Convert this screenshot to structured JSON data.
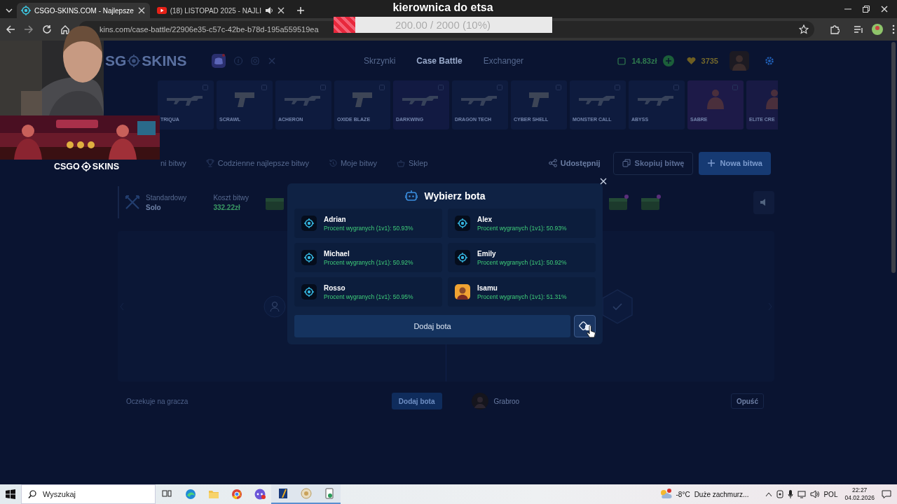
{
  "browser": {
    "tabs": [
      {
        "title": "CSGO-SKINS.COM - Najlepsze",
        "kind": "site",
        "selected": true
      },
      {
        "title": "(18) LISTOPAD 2025 - NAJLI",
        "kind": "video",
        "selected": false
      }
    ],
    "address": "kins.com/case-battle/22906e35-c57c-42be-b78d-195a559519ea"
  },
  "stream": {
    "goal_title": "kierownica do etsa",
    "goal_reading": "200.00 / 2000 (10%)",
    "level": 0.1,
    "logo_left": "CSGO",
    "logo_right": "SKINS"
  },
  "header": {
    "logo_left": "SG",
    "logo_right": "SKINS",
    "nav": [
      {
        "label": "Skrzynki",
        "selected": false
      },
      {
        "label": "Case Battle",
        "selected": true
      },
      {
        "label": "Exchanger",
        "selected": false
      }
    ],
    "balance": "14.83zł",
    "coins": "3735"
  },
  "drops": [
    {
      "name": "TRIQUA",
      "kind": "rifle",
      "color": "#0e1b3e"
    },
    {
      "name": "SCRAWL",
      "kind": "pistol",
      "color": "#0e1b3e"
    },
    {
      "name": "ACHERON",
      "kind": "rifle",
      "color": "#0e1b3e"
    },
    {
      "name": "OXIDE BLAZE",
      "kind": "pistol",
      "color": "#0e1b3e"
    },
    {
      "name": "DARKWING",
      "kind": "rifle",
      "color": "#121a42"
    },
    {
      "name": "DRAGON TECH",
      "kind": "rifle",
      "color": "#0e1b3e"
    },
    {
      "name": "CYBER SHELL",
      "kind": "pistol",
      "color": "#0e1b3e"
    },
    {
      "name": "MONSTER CALL",
      "kind": "rifle",
      "color": "#0e1b3e"
    },
    {
      "name": "ABYSS",
      "kind": "rifle",
      "color": "#0e1b3e"
    },
    {
      "name": "SABRE",
      "kind": "agent",
      "color": "#1d1a48"
    },
    {
      "name": "ELITE CRE",
      "kind": "agent",
      "color": "#181a44"
    }
  ],
  "battle_tabs": [
    {
      "label": "ni bitwy",
      "kind": "none",
      "selected": false
    },
    {
      "label": "Codzienne najlepsze bitwy",
      "kind": "trophy",
      "selected": false
    },
    {
      "label": "Moje bitwy",
      "kind": "history",
      "selected": false
    },
    {
      "label": "Sklep",
      "kind": "basket",
      "selected": false
    }
  ],
  "actions": {
    "share": "Udostępnij",
    "copy": "Skopiuj bitwę",
    "new": "Nowa bitwa"
  },
  "battle": {
    "mode_label": "Standardowy",
    "mode": "Solo",
    "cost_label": "Koszt bitwy",
    "cost": "332.22zł"
  },
  "slots": [
    {
      "kind": "empty",
      "status": "Oczekuje na gracza",
      "button": "Dodaj bota"
    },
    {
      "kind": "player",
      "name": "Grabroo",
      "button": "Opuść"
    }
  ],
  "modal": {
    "title": "Wybierz bota",
    "add_button": "Dodaj bota",
    "bots": [
      {
        "name": "Adrian",
        "stat": "Procent wygranych (1v1): 50.93%",
        "kind": "target"
      },
      {
        "name": "Alex",
        "stat": "Procent wygranych (1v1): 50.93%",
        "kind": "target"
      },
      {
        "name": "Michael",
        "stat": "Procent wygranych (1v1): 50.92%",
        "kind": "target"
      },
      {
        "name": "Emily",
        "stat": "Procent wygranych (1v1): 50.92%",
        "kind": "target"
      },
      {
        "name": "Rosso",
        "stat": "Procent wygranych (1v1): 50.95%",
        "kind": "target"
      },
      {
        "name": "Isamu",
        "stat": "Procent wygranych (1v1): 51.31%",
        "kind": "avatar"
      }
    ]
  },
  "taskbar": {
    "search_placeholder": "Wyszukaj",
    "temperature": "-8°C",
    "weather": "Duże zachmurz...",
    "language": "POL",
    "time": "22:27",
    "date": "04.02.2026"
  }
}
